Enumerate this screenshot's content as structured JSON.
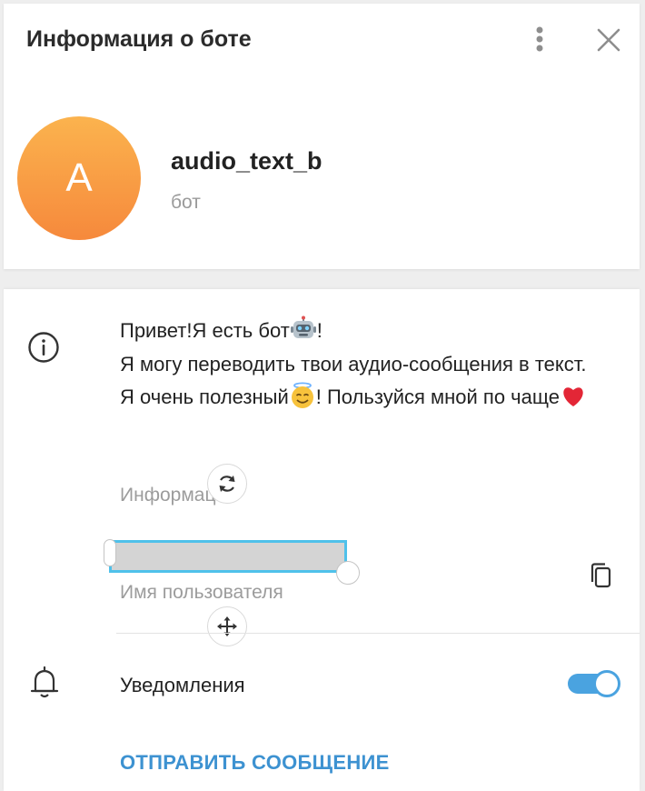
{
  "header": {
    "title": "Информация о боте"
  },
  "profile": {
    "avatar_letter": "A",
    "name": "audio_text_b",
    "status": "бот"
  },
  "about": {
    "line1": "Привет!Я есть бот",
    "line1_end": "!",
    "line2": "Я могу переводить твои аудио-сообщения в текст.",
    "line3_start": "Я очень полезный",
    "line3_end": "! Пользуйся мной по чаще",
    "label": "Информация"
  },
  "username": {
    "value": "",
    "label": "Имя пользователя"
  },
  "notifications": {
    "label": "Уведомления",
    "enabled": true
  },
  "actions": {
    "send_message": "ОТПРАВИТЬ СООБЩЕНИЕ"
  },
  "colors": {
    "accent": "#4aa3e0",
    "link": "#3d92d1",
    "selection_border": "#4fc1ea",
    "avatar_top": "#fbb34e",
    "avatar_bottom": "#f6893c"
  },
  "icons": [
    "more-vertical-icon",
    "close-icon",
    "info-icon",
    "robot-emoji-icon",
    "halo-emoji-icon",
    "heart-emoji-icon",
    "rotate-icon",
    "copy-icon",
    "move-icon",
    "bell-icon"
  ]
}
